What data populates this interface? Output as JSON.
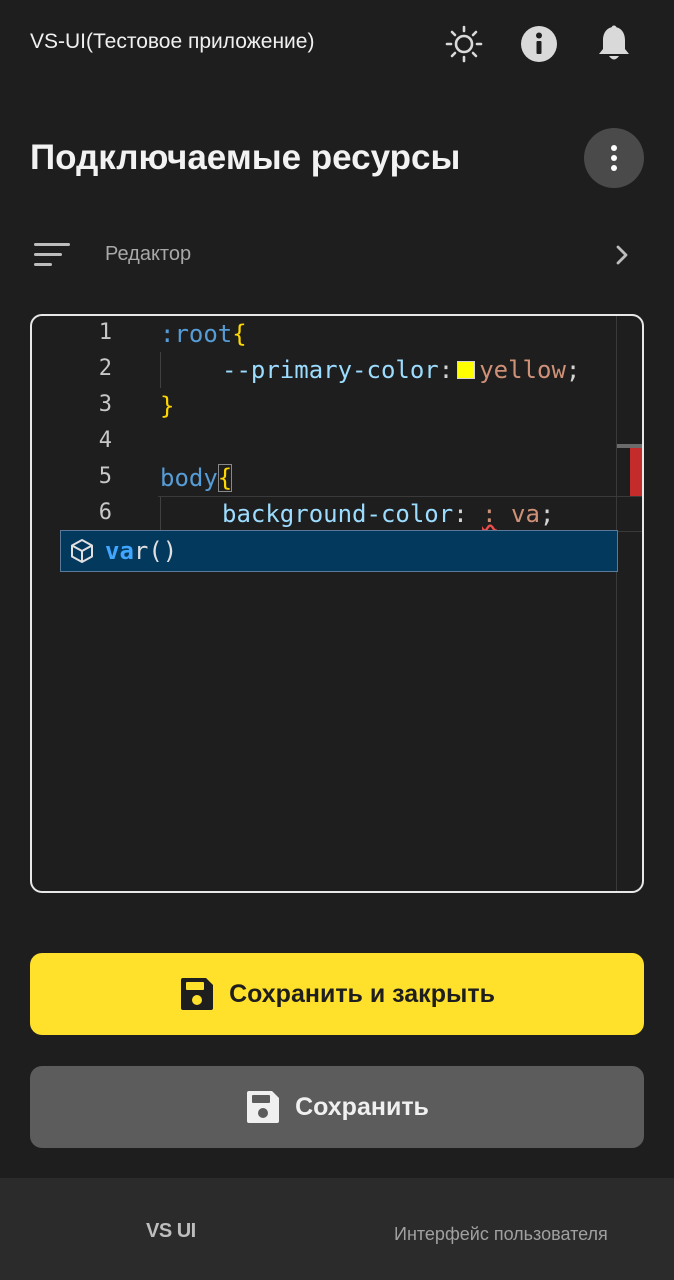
{
  "app": {
    "title": "VS-UI(Тестовое приложение)"
  },
  "icons": {
    "theme": "sun-icon",
    "info": "info-icon",
    "notifications": "bell-icon",
    "more": "more-vertical-icon",
    "menu": "menu-lines-icon",
    "chevron": "chevron-right-icon",
    "suggest": "cube-icon",
    "save": "floppy-disk-icon"
  },
  "page": {
    "title": "Подключаемые ресурсы"
  },
  "breadcrumb": {
    "label": "Редактор"
  },
  "editor": {
    "lines": [
      {
        "num": "1",
        "tokens": [
          ":root",
          "{"
        ]
      },
      {
        "num": "2",
        "tokens": [
          "--primary-color",
          ":",
          "yellow",
          ";"
        ]
      },
      {
        "num": "3",
        "tokens": [
          "}"
        ]
      },
      {
        "num": "4",
        "tokens": []
      },
      {
        "num": "5",
        "tokens": [
          "body",
          "{"
        ]
      },
      {
        "num": "6",
        "tokens": [
          "background-color",
          ":",
          ":",
          "va",
          ";"
        ]
      }
    ],
    "swatch_color": "#ffff00",
    "suggestion": {
      "match": "va",
      "rest": "r()"
    }
  },
  "actions": {
    "save_close_label": "Сохранить и закрыть",
    "save_label": "Сохранить"
  },
  "footer": {
    "logo": "VS UI",
    "text": "Интерфейс пользователя"
  },
  "colors": {
    "background": "#1e1e1e",
    "accent": "#ffe02a",
    "secondary_button": "#5c5c5c",
    "footer": "#2b2b2b",
    "suggest_bg": "#04395e"
  }
}
